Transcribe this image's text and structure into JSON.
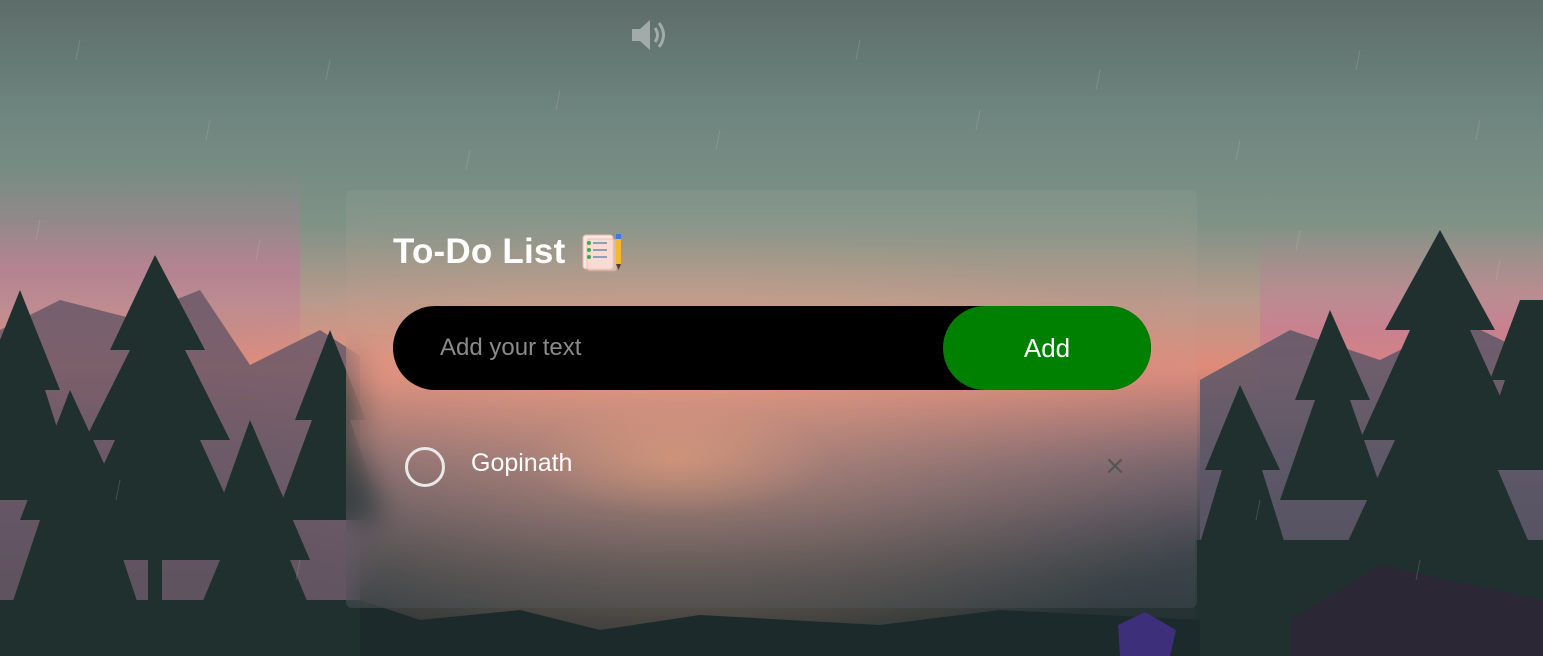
{
  "app": {
    "title": "To-Do List",
    "title_icon": "notepad-pencil-icon",
    "sound_icon": "speaker-icon"
  },
  "input": {
    "placeholder": "Add your text",
    "value": ""
  },
  "buttons": {
    "add_label": "Add"
  },
  "tasks": [
    {
      "text": "Gopinath",
      "checked": false,
      "delete_icon": "close-icon",
      "delete_glyph": "×"
    }
  ],
  "colors": {
    "add_button": "#008000",
    "input_background": "#000000",
    "title_text": "#ffffff"
  }
}
